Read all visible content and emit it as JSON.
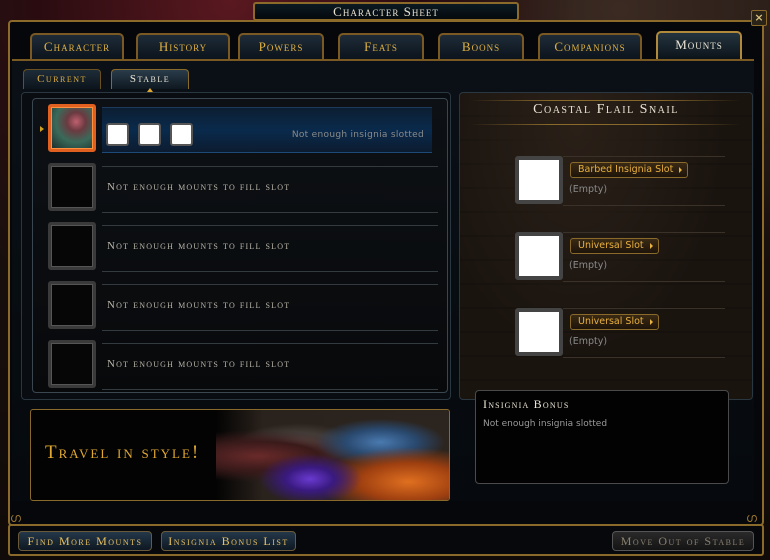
{
  "window": {
    "title": "Character Sheet",
    "close_icon": "close-x-icon"
  },
  "main_tabs": [
    {
      "label": "Character",
      "active": false
    },
    {
      "label": "History",
      "active": false
    },
    {
      "label": "Powers",
      "active": false
    },
    {
      "label": "Feats",
      "active": false
    },
    {
      "label": "Boons",
      "active": false
    },
    {
      "label": "Companions",
      "active": false
    },
    {
      "label": "Mounts",
      "active": true
    }
  ],
  "sub_tabs": [
    {
      "label": "Current",
      "active": false
    },
    {
      "label": "Stable",
      "active": true
    }
  ],
  "stable": {
    "selected": {
      "name": "Coastal Flail Snail",
      "insignia_slots": 3,
      "status": "Not enough insignia slotted"
    },
    "empty_slots": [
      {
        "text": "Not enough mounts to fill slot"
      },
      {
        "text": "Not enough mounts to fill slot"
      },
      {
        "text": "Not enough mounts to fill slot"
      },
      {
        "text": "Not enough mounts to fill slot"
      }
    ]
  },
  "banner": {
    "text": "Travel in style!"
  },
  "detail": {
    "mount_name": "Coastal Flail Snail",
    "slots": [
      {
        "type": "Barbed Insignia Slot",
        "content": "(Empty)"
      },
      {
        "type": "Universal Slot",
        "content": "(Empty)"
      },
      {
        "type": "Universal Slot",
        "content": "(Empty)"
      }
    ],
    "bonus": {
      "title": "Insignia Bonus",
      "text": "Not enough insignia slotted"
    }
  },
  "footer": {
    "find_more": "Find More Mounts",
    "bonus_list": "Insignia Bonus List",
    "move_out": "Move Out of Stable"
  },
  "colors": {
    "gold_accent": "#e0b040",
    "border_gold": "#8a6a2a",
    "selected_border": "#e06020"
  }
}
